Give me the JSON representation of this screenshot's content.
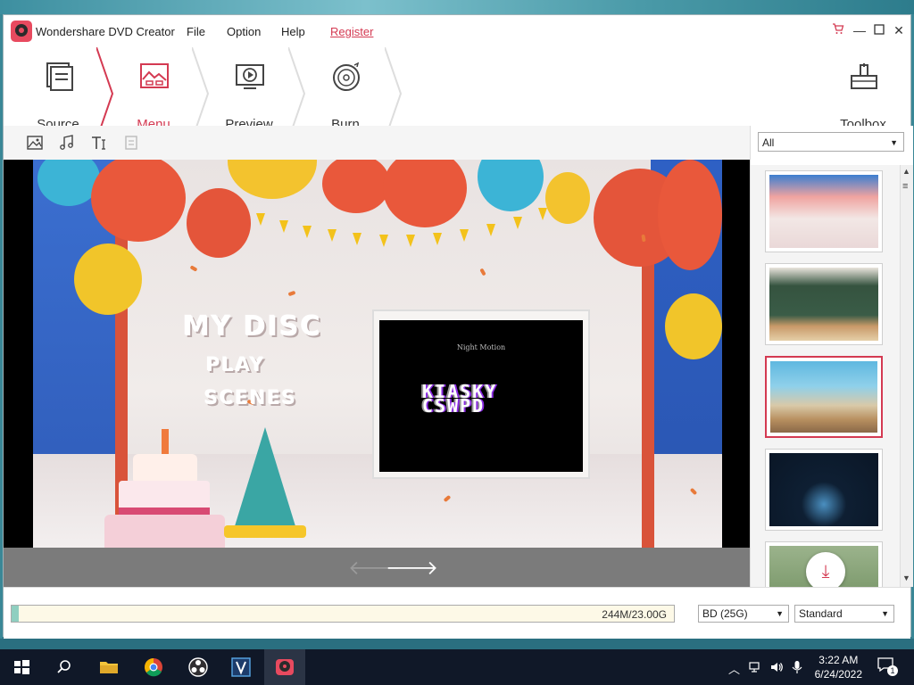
{
  "window": {
    "title": "Wondershare DVD Creator",
    "menu": [
      "File",
      "Option",
      "Help"
    ],
    "register": "Register"
  },
  "steps": [
    {
      "label": "Source",
      "icon": "source-icon"
    },
    {
      "label": "Menu",
      "icon": "menu-image-icon",
      "active": true
    },
    {
      "label": "Preview",
      "icon": "preview-play-icon"
    },
    {
      "label": "Burn",
      "icon": "burn-disc-icon"
    }
  ],
  "toolbox": {
    "label": "Toolbox",
    "icon": "toolbox-icon"
  },
  "toolbar_icons": [
    "image-icon",
    "music-note-icon",
    "text-icon",
    "chapter-icon"
  ],
  "preview": {
    "menu_title": "MY DISC",
    "menu_play": "PLAY",
    "menu_scenes": "SCENES",
    "tv_small_text": "Night Motion",
    "tv_glitch_text": "KIASKY\nCSWPD"
  },
  "filter": {
    "selected": "All"
  },
  "templates": [
    {
      "name": "birthday-balloons",
      "selected": false
    },
    {
      "name": "classroom-chalkboard",
      "selected": false
    },
    {
      "name": "beach-vacation",
      "selected": true
    },
    {
      "name": "night-disc",
      "selected": false
    },
    {
      "name": "green-hills",
      "selected": false
    }
  ],
  "status": {
    "usage": "244M/23.00G",
    "usage_fraction": 0.011,
    "disc_type": "BD (25G)",
    "quality": "Standard"
  },
  "taskbar": {
    "time": "3:22 AM",
    "date": "6/24/2022",
    "notifications": "1"
  },
  "colors": {
    "accent": "#d43a52",
    "taskbar": "#101828"
  }
}
